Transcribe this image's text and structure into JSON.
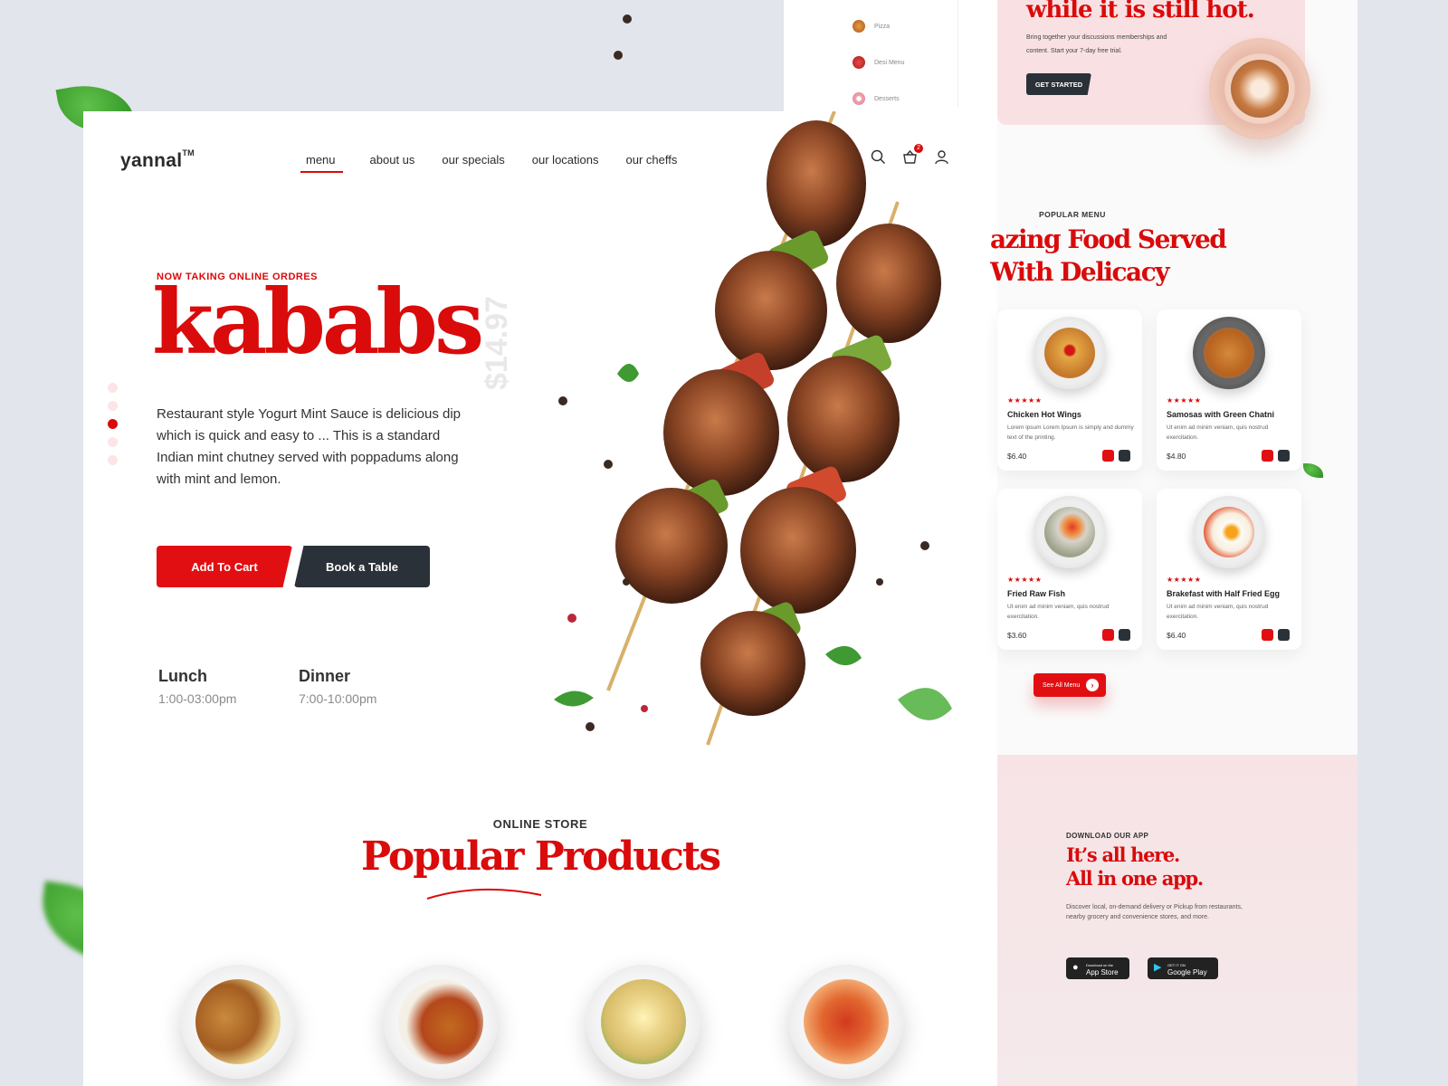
{
  "brand": {
    "name": "yannal",
    "tm": "TM"
  },
  "nav": [
    {
      "label": "menu",
      "active": true
    },
    {
      "label": "about us"
    },
    {
      "label": "our specials"
    },
    {
      "label": "our locations"
    },
    {
      "label": "our cheffs"
    }
  ],
  "header_icons": [
    "search-icon",
    "basket-icon",
    "user-icon"
  ],
  "cart_count": "2",
  "hero": {
    "eyebrow": "NOW TAKING ONLINE ORDRES",
    "title": "kababs",
    "price": "$14.97",
    "description": "Restaurant style Yogurt Mint Sauce is delicious dip which is quick and easy to ... This is a standard Indian mint chutney served with poppadums along with mint and lemon.",
    "add_to_cart": "Add To Cart",
    "book_table": "Book a Table",
    "active_slide": 3,
    "slide_count": 5
  },
  "hours": [
    {
      "label": "Lunch",
      "time": "1:00-03:00pm"
    },
    {
      "label": "Dinner",
      "time": "7:00-10:00pm"
    }
  ],
  "store": {
    "eyebrow": "ONLINE STORE",
    "title": "Popular Products"
  },
  "products": [
    {
      "icon": "fried-chicken-plate"
    },
    {
      "icon": "curry-rice-plate"
    },
    {
      "icon": "crepe-lemon-plate"
    },
    {
      "icon": "spaghetti-plate"
    }
  ],
  "categories": [
    {
      "label": "Pizza",
      "icon": "pizza-icon"
    },
    {
      "label": "Desi Menu",
      "icon": "pot-icon"
    },
    {
      "label": "Desserts",
      "icon": "donut-icon"
    }
  ],
  "promo": {
    "title": "while it is still hot.",
    "text": "Bring together your discussions memberships and content. Start your 7-day free trial.",
    "button": "GET STARTED"
  },
  "popular_menu": {
    "eyebrow": "POPULAR MENU",
    "title_line1": "azing Food Served",
    "title_line2": "With Delicacy",
    "stars": "★★★★★",
    "items": [
      {
        "name": "Chicken Hot Wings",
        "desc": "Lorem ipsum Lorem Ipsum is simply and dummy text of the printing.",
        "price": "$6.40"
      },
      {
        "name": "Samosas with Green Chatni",
        "desc": "Ut enim ad minim veniam, quis nostrud exercitation.",
        "price": "$4.80"
      },
      {
        "name": "Fried Raw Fish",
        "desc": "Ut enim ad minim veniam, quis nostrud exercitation.",
        "price": "$3.60"
      },
      {
        "name": "Brakefast with Half Fried Egg",
        "desc": "Ut enim ad minim veniam, quis nostrud exercitation.",
        "price": "$6.40"
      }
    ],
    "see_all": "See All Menu"
  },
  "app": {
    "eyebrow": "DOWNLOAD OUR APP",
    "title_line1": "It’s all here.",
    "title_line2": "All in one app.",
    "desc": "Discover local, on-demand delivery or Pickup from restaurants, nearby grocery and convenience stores, and more.",
    "app_store_small": "Download on the",
    "app_store": "App Store",
    "google_play_small": "GET IT ON",
    "google_play": "Google Play"
  },
  "colors": {
    "accent": "#d90b0b",
    "dark": "#2b3138",
    "pink_bg": "#f9e1e3"
  }
}
